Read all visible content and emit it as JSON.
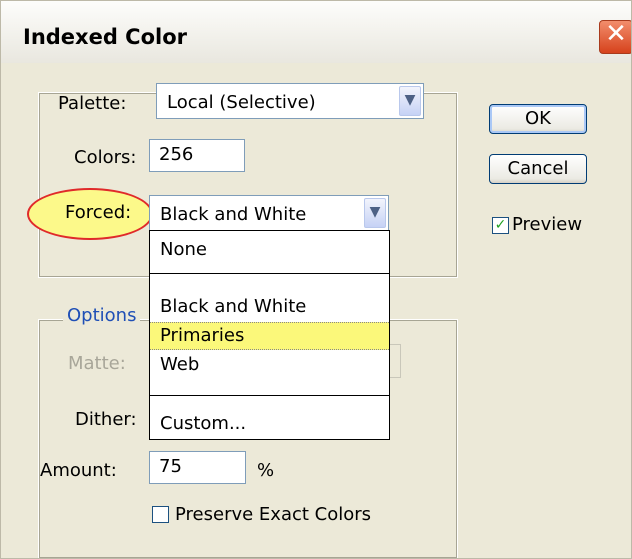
{
  "window": {
    "title": "Indexed Color",
    "close_symbol": "✕"
  },
  "palette": {
    "label": "Palette:",
    "value": "Local (Selective)"
  },
  "colors": {
    "label": "Colors:",
    "value": "256"
  },
  "forced": {
    "label": "Forced:",
    "value": "Black and White",
    "options": [
      "None",
      "Black and White",
      "Primaries",
      "Web",
      "Custom..."
    ],
    "highlighted": "Primaries"
  },
  "options_group": {
    "legend": "Options",
    "matte_label": "Matte:",
    "dither_label": "Dither:",
    "amount_label": "Amount:",
    "amount_value": "75",
    "amount_unit": "%",
    "preserve_label": "Preserve Exact Colors",
    "preserve_checked": false
  },
  "buttons": {
    "ok": "OK",
    "cancel": "Cancel"
  },
  "preview": {
    "label": "Preview",
    "checked": true,
    "check_symbol": "✓"
  },
  "colors_accent": {
    "highlight_fill": "#fbf87a",
    "ellipse_stroke": "#e02a2a",
    "legend_blue": "#1f4fb6"
  }
}
